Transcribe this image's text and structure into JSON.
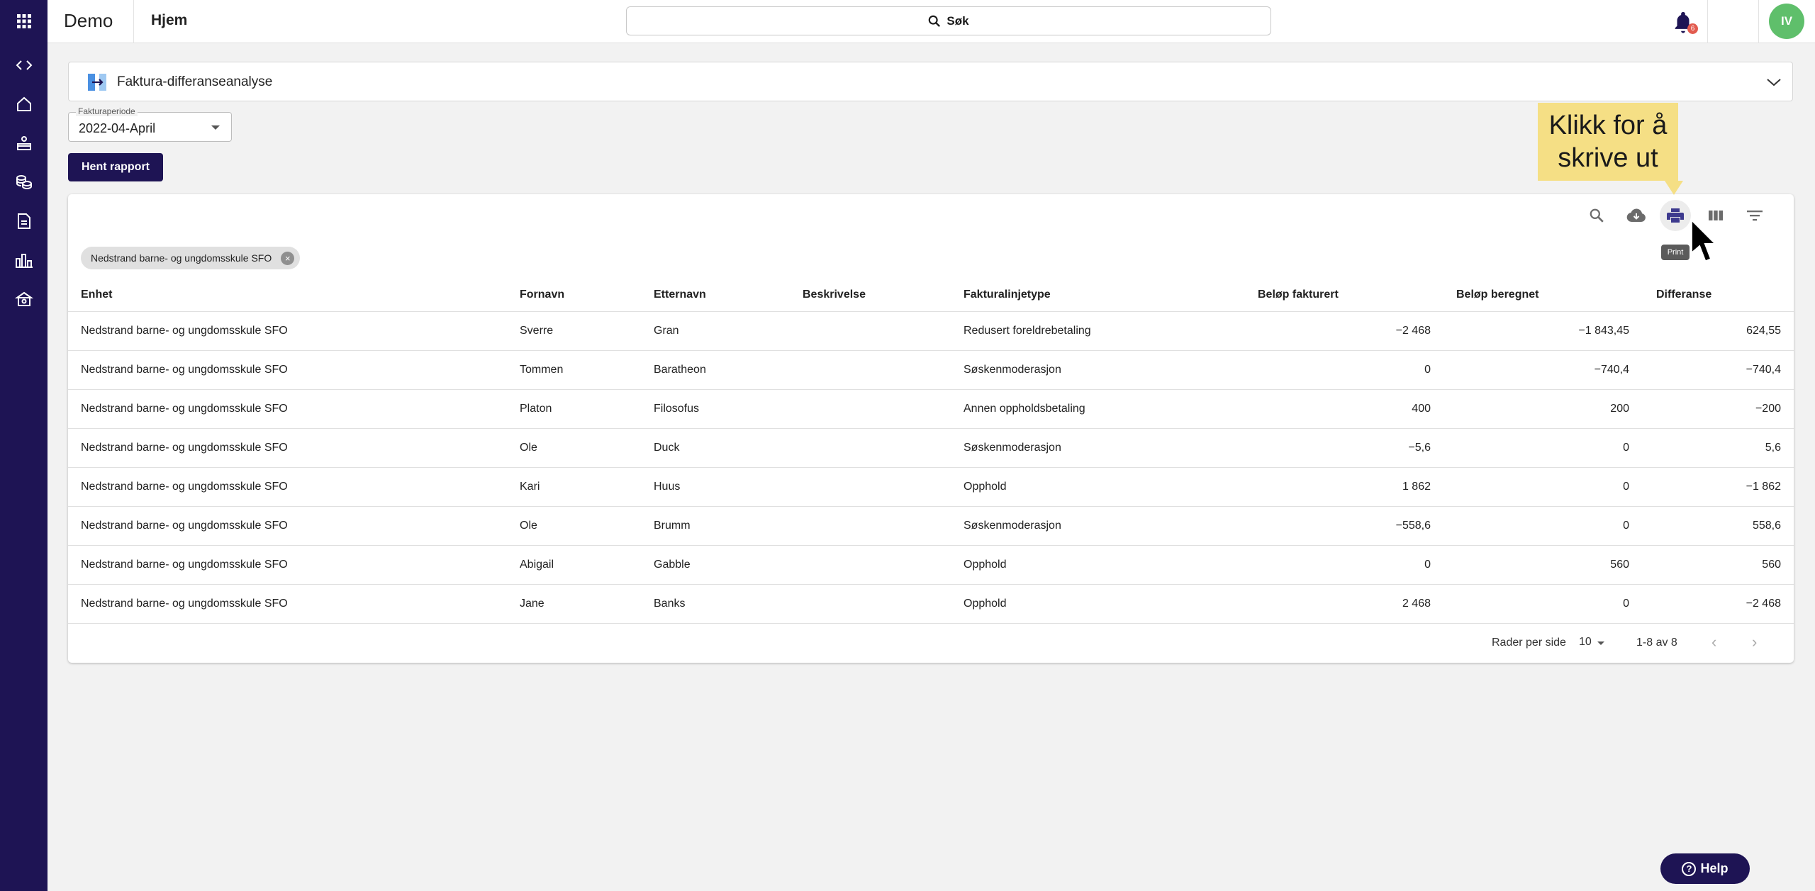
{
  "app": {
    "title": "Demo",
    "page": "Hjem"
  },
  "search": {
    "label": "Søk"
  },
  "notifications": {
    "count": "6"
  },
  "user": {
    "initials": "IV"
  },
  "report": {
    "title": "Faktura-differanseanalyse",
    "period_label": "Fakturaperiode",
    "period_value": "2022-04-April",
    "get_button": "Hent rapport"
  },
  "toolbar": {
    "print_tooltip": "Print"
  },
  "callout": {
    "line1": "Klikk for å",
    "line2": "skrive ut"
  },
  "filter_chip": "Nedstrand barne- og ungdomsskule SFO",
  "table": {
    "columns": [
      "Enhet",
      "Fornavn",
      "Etternavn",
      "Beskrivelse",
      "Fakturalinjetype",
      "Beløp fakturert",
      "Beløp beregnet",
      "Differanse"
    ],
    "rows": [
      [
        "Nedstrand barne- og ungdomsskule SFO",
        "Sverre",
        "Gran",
        "",
        "Redusert foreldrebetaling",
        "−2 468",
        "−1 843,45",
        "624,55"
      ],
      [
        "Nedstrand barne- og ungdomsskule SFO",
        "Tommen",
        "Baratheon",
        "",
        "Søskenmoderasjon",
        "0",
        "−740,4",
        "−740,4"
      ],
      [
        "Nedstrand barne- og ungdomsskule SFO",
        "Platon",
        "Filosofus",
        "",
        "Annen oppholdsbetaling",
        "400",
        "200",
        "−200"
      ],
      [
        "Nedstrand barne- og ungdomsskule SFO",
        "Ole",
        "Duck",
        "",
        "Søskenmoderasjon",
        "−5,6",
        "0",
        "5,6"
      ],
      [
        "Nedstrand barne- og ungdomsskule SFO",
        "Kari",
        "Huus",
        "",
        "Opphold",
        "1 862",
        "0",
        "−1 862"
      ],
      [
        "Nedstrand barne- og ungdomsskule SFO",
        "Ole",
        "Brumm",
        "",
        "Søskenmoderasjon",
        "−558,6",
        "0",
        "558,6"
      ],
      [
        "Nedstrand barne- og ungdomsskule SFO",
        "Abigail",
        "Gabble",
        "",
        "Opphold",
        "0",
        "560",
        "560"
      ],
      [
        "Nedstrand barne- og ungdomsskule SFO",
        "Jane",
        "Banks",
        "",
        "Opphold",
        "2 468",
        "0",
        "−2 468"
      ]
    ]
  },
  "pagination": {
    "rows_per_page_label": "Rader per side",
    "rows_per_page": "10",
    "range": "1-8 av 8",
    "prev": "‹",
    "next": "›"
  },
  "help": {
    "label": "Help"
  },
  "colors": {
    "primary": "#1e1454",
    "callout": "#f5df85",
    "avatar": "#5fbf6b",
    "badge": "#e25b4f"
  }
}
